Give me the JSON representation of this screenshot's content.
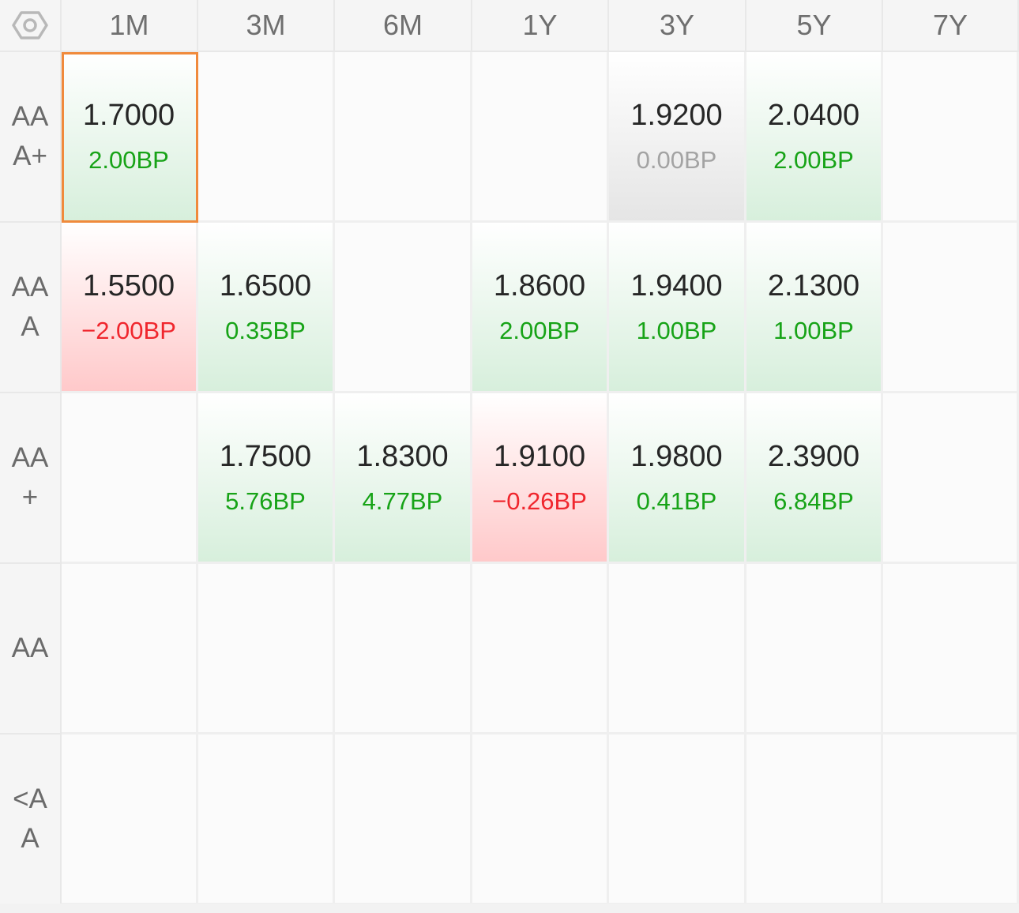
{
  "corner": {
    "icon": "settings-hex-icon"
  },
  "colors": {
    "up": "#17a317",
    "down": "#f0262d",
    "flat": "#a3a3a3",
    "selected_border": "#f08a3c"
  },
  "columns": [
    "1M",
    "3M",
    "6M",
    "1Y",
    "3Y",
    "5Y",
    "7Y"
  ],
  "rows": [
    {
      "label": "AAA+",
      "cells": [
        {
          "value": "1.7000",
          "change": "2.00BP",
          "dir": "up",
          "selected": true
        },
        null,
        null,
        null,
        {
          "value": "1.9200",
          "change": "0.00BP",
          "dir": "flat"
        },
        {
          "value": "2.0400",
          "change": "2.00BP",
          "dir": "up"
        },
        null
      ]
    },
    {
      "label": "AAA",
      "cells": [
        {
          "value": "1.5500",
          "change": "−2.00BP",
          "dir": "down"
        },
        {
          "value": "1.6500",
          "change": "0.35BP",
          "dir": "up"
        },
        null,
        {
          "value": "1.8600",
          "change": "2.00BP",
          "dir": "up"
        },
        {
          "value": "1.9400",
          "change": "1.00BP",
          "dir": "up"
        },
        {
          "value": "2.1300",
          "change": "1.00BP",
          "dir": "up"
        },
        null
      ]
    },
    {
      "label": "AA+",
      "cells": [
        null,
        {
          "value": "1.7500",
          "change": "5.76BP",
          "dir": "up"
        },
        {
          "value": "1.8300",
          "change": "4.77BP",
          "dir": "up"
        },
        {
          "value": "1.9100",
          "change": "−0.26BP",
          "dir": "down"
        },
        {
          "value": "1.9800",
          "change": "0.41BP",
          "dir": "up"
        },
        {
          "value": "2.3900",
          "change": "6.84BP",
          "dir": "up"
        },
        null
      ]
    },
    {
      "label": "AA",
      "cells": [
        null,
        null,
        null,
        null,
        null,
        null,
        null
      ]
    },
    {
      "label": "<AA",
      "cells": [
        null,
        null,
        null,
        null,
        null,
        null,
        null
      ]
    }
  ]
}
